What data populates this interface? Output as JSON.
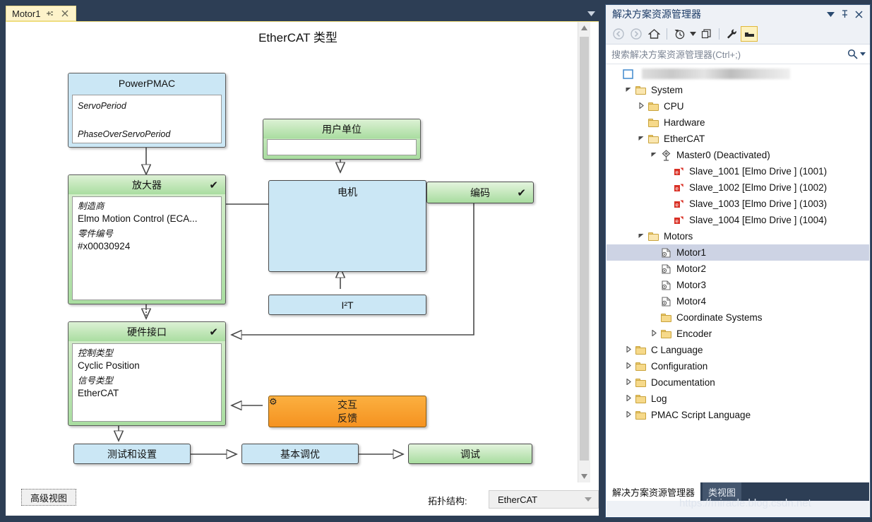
{
  "editor": {
    "tab": {
      "label": "Motor1",
      "pin_icon": "pin-icon",
      "close_icon": "close-icon"
    },
    "tab_dropdown_icon": "chevron-down-icon",
    "title": "EtherCAT 类型",
    "advanced_view_button": "高级视图",
    "topology_label": "拓扑结构:",
    "topology_value": "EtherCAT",
    "topology_chevron": "chevron-down-icon"
  },
  "diagram": {
    "powerpmac": {
      "header": "PowerPMAC",
      "fields": [
        "ServoPeriod",
        "PhaseOverServoPeriod"
      ]
    },
    "amplifier": {
      "header": "放大器",
      "check": "✔",
      "field1_label": "制造商",
      "field1_value": "Elmo Motion Control (ECA...",
      "field2_label": "零件编号",
      "field2_value": "#x00030924"
    },
    "hardware_interface": {
      "header": "硬件接口",
      "check": "✔",
      "field1_label": "控制类型",
      "field1_value": "Cyclic Position",
      "field2_label": "信号类型",
      "field2_value": "EtherCAT"
    },
    "user_units": {
      "header": "用户单位",
      "value": ""
    },
    "motor": {
      "header": "电机"
    },
    "encoder": {
      "header": "编码",
      "check": "✔"
    },
    "i2t": {
      "header": "I²T"
    },
    "interactive_feedback": {
      "line1": "交互",
      "line2": "反馈",
      "gear_icon": "gear-icon"
    },
    "test_and_set": "测试和设置",
    "basic_tuning": "基本调优",
    "commissioning": "调试"
  },
  "solution_explorer": {
    "title": "解决方案资源管理器",
    "header_icons": [
      "chevron-down-icon",
      "pin-icon",
      "close-icon"
    ],
    "toolbar": [
      "back-icon",
      "forward-icon",
      "home-icon",
      "pending-changes-filter-icon",
      "chevron-down-icon",
      "show-all-files-icon",
      "properties-wrench-icon",
      "collapse-all-icon"
    ],
    "search_placeholder": "搜索解决方案资源管理器(Ctrl+;)",
    "search_icon": "search-icon",
    "search_dropdown_icon": "chevron-down-icon",
    "tree": [
      {
        "label": "",
        "indent": 0,
        "twisty": "",
        "icon": "solution-icon",
        "redacted": true
      },
      {
        "label": "System",
        "indent": 1,
        "twisty": "expanded",
        "icon": "folder-open-icon"
      },
      {
        "label": "CPU",
        "indent": 2,
        "twisty": "collapsed",
        "icon": "folder-icon"
      },
      {
        "label": "Hardware",
        "indent": 2,
        "twisty": "",
        "icon": "folder-icon"
      },
      {
        "label": "EtherCAT",
        "indent": 2,
        "twisty": "expanded",
        "icon": "folder-open-icon"
      },
      {
        "label": "Master0 (Deactivated)",
        "indent": 3,
        "twisty": "expanded",
        "icon": "master-node-icon"
      },
      {
        "label": "Slave_1001 [Elmo Drive ] (1001)",
        "indent": 4,
        "twisty": "",
        "icon": "slave-device-icon"
      },
      {
        "label": "Slave_1002 [Elmo Drive ] (1002)",
        "indent": 4,
        "twisty": "",
        "icon": "slave-device-icon"
      },
      {
        "label": "Slave_1003 [Elmo Drive ] (1003)",
        "indent": 4,
        "twisty": "",
        "icon": "slave-device-icon"
      },
      {
        "label": "Slave_1004 [Elmo Drive ] (1004)",
        "indent": 4,
        "twisty": "",
        "icon": "slave-device-icon"
      },
      {
        "label": "Motors",
        "indent": 2,
        "twisty": "expanded",
        "icon": "folder-open-icon"
      },
      {
        "label": "Motor1",
        "indent": 3,
        "twisty": "",
        "icon": "motor-icon",
        "selected": true
      },
      {
        "label": "Motor2",
        "indent": 3,
        "twisty": "",
        "icon": "motor-icon"
      },
      {
        "label": "Motor3",
        "indent": 3,
        "twisty": "",
        "icon": "motor-icon"
      },
      {
        "label": "Motor4",
        "indent": 3,
        "twisty": "",
        "icon": "motor-icon"
      },
      {
        "label": "Coordinate Systems",
        "indent": 3,
        "twisty": "",
        "icon": "folder-icon"
      },
      {
        "label": "Encoder",
        "indent": 3,
        "twisty": "collapsed",
        "icon": "folder-icon"
      },
      {
        "label": "C Language",
        "indent": 1,
        "twisty": "collapsed",
        "icon": "folder-icon"
      },
      {
        "label": "Configuration",
        "indent": 1,
        "twisty": "collapsed",
        "icon": "folder-icon"
      },
      {
        "label": "Documentation",
        "indent": 1,
        "twisty": "collapsed",
        "icon": "folder-icon"
      },
      {
        "label": "Log",
        "indent": 1,
        "twisty": "collapsed",
        "icon": "folder-icon"
      },
      {
        "label": "PMAC Script Language",
        "indent": 1,
        "twisty": "collapsed",
        "icon": "folder-icon"
      }
    ],
    "bottom_tabs": [
      {
        "label": "解决方案资源管理器",
        "active": true
      },
      {
        "label": "类视图",
        "active": false
      }
    ]
  },
  "watermark": "https://miracle.blog.csdn.net",
  "colors": {
    "chrome": "#2d3e55",
    "tab_active": "#fdf3ca",
    "node_blue": "#cbe7f5",
    "node_green": "#a9dda0",
    "node_orange": "#f59220",
    "selection": "#cdd3e4"
  }
}
